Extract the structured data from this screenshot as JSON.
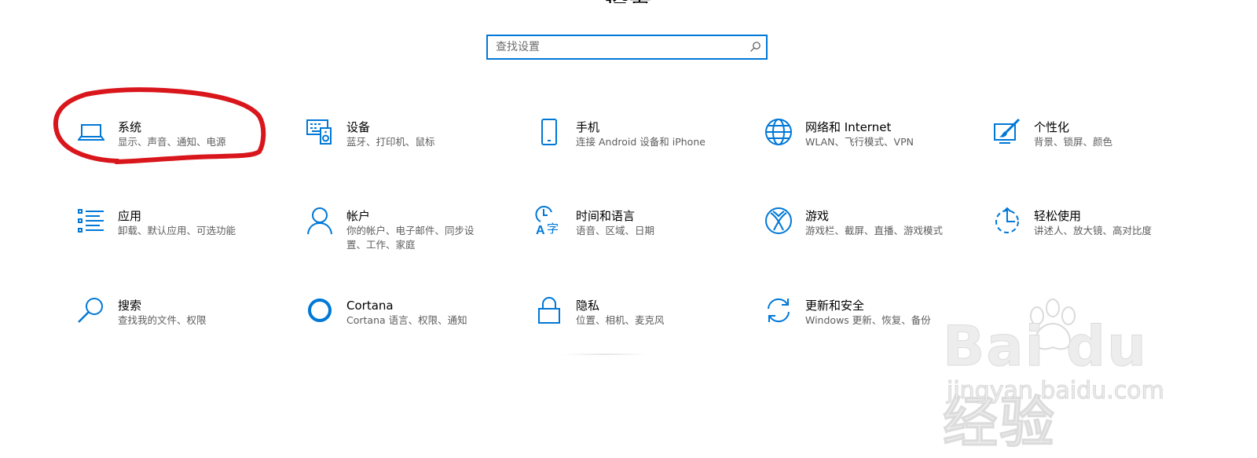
{
  "window": {
    "title": "设置"
  },
  "search": {
    "placeholder": "查找设置"
  },
  "tiles": [
    {
      "label": "系统",
      "desc": "显示、声音、通知、电源",
      "icon": "laptop-icon"
    },
    {
      "label": "设备",
      "desc": "蓝牙、打印机、鼠标",
      "icon": "keyboard-speaker-icon"
    },
    {
      "label": "手机",
      "desc": "连接 Android 设备和 iPhone",
      "icon": "phone-icon"
    },
    {
      "label": "网络和 Internet",
      "desc": "WLAN、飞行模式、VPN",
      "icon": "globe-icon"
    },
    {
      "label": "个性化",
      "desc": "背景、锁屏、颜色",
      "icon": "paintbrush-icon"
    },
    {
      "label": "应用",
      "desc": "卸载、默认应用、可选功能",
      "icon": "apps-list-icon"
    },
    {
      "label": "帐户",
      "desc": "你的帐户、电子邮件、同步设置、工作、家庭",
      "icon": "person-icon"
    },
    {
      "label": "时间和语言",
      "desc": "语音、区域、日期",
      "icon": "time-language-icon"
    },
    {
      "label": "游戏",
      "desc": "游戏栏、截屏、直播、游戏模式",
      "icon": "xbox-icon"
    },
    {
      "label": "轻松使用",
      "desc": "讲述人、放大镜、高对比度",
      "icon": "ease-of-access-icon"
    },
    {
      "label": "搜索",
      "desc": "查找我的文件、权限",
      "icon": "search-icon"
    },
    {
      "label": "Cortana",
      "desc": "Cortana 语言、权限、通知",
      "icon": "cortana-ring-icon"
    },
    {
      "label": "隐私",
      "desc": "位置、相机、麦克风",
      "icon": "lock-icon"
    },
    {
      "label": "更新和安全",
      "desc": "Windows 更新、恢复、备份",
      "icon": "sync-arrows-icon"
    }
  ],
  "watermark": {
    "logo": "Bai du 经验",
    "url": "jingyan.baidu.com"
  },
  "colors": {
    "accent": "#0078d7",
    "annotation": "#d9161c"
  }
}
